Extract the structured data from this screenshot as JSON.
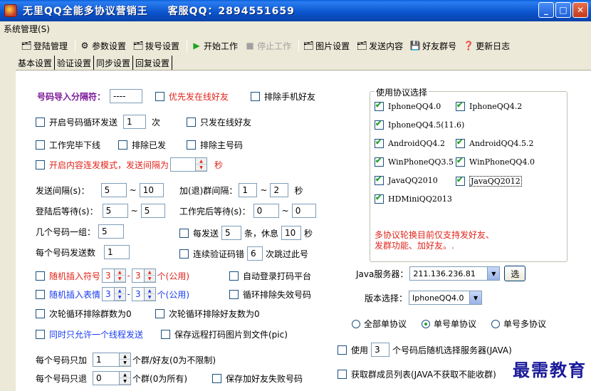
{
  "window": {
    "title": "无里QQ全能多协议营销王",
    "support": "客服QQ：2894551659",
    "min": "_",
    "max": "□",
    "close": "✕"
  },
  "menu": {
    "system": "系统管理(S)"
  },
  "toolbar": {
    "login": "登陆管理",
    "params": "参数设置",
    "dial": "拨号设置",
    "start": "开始工作",
    "stop": "停止工作",
    "image": "图片设置",
    "send": "发送内容",
    "group": "好友群号",
    "log": "更新日志"
  },
  "tabs": [
    "基本设置",
    "验证设置",
    "同步设置",
    "回复设置"
  ],
  "form": {
    "sep_label": "号码导入分隔符：",
    "sep_value": "----",
    "prio_online": "优先发在线好友",
    "excl_mobile": "排除手机好友",
    "loop_send": "开启号码循环发送",
    "loop_count": "1",
    "loop_unit": "次",
    "online_only": "只发在线好友",
    "offline_after": "工作完毕下线",
    "excl_sent": "排除已发",
    "excl_main": "排除主号码",
    "burst_mode": "开启内容连发模式，发送间隔为",
    "burst_value": "",
    "burst_unit": "秒",
    "send_interval": "发送间隔(s)：",
    "send_min": "5",
    "send_max": "10",
    "tilde": "~",
    "group_interval": "加(退)群间隔：",
    "group_min": "1",
    "group_max": "2",
    "group_unit": "秒",
    "login_wait": "登陆后等待(s)：",
    "login_min": "5",
    "login_max": "5",
    "done_wait": "工作完后等待(s)：",
    "done_min": "0",
    "done_max": "0",
    "per_group": "几个号码一组：",
    "per_group_val": "5",
    "each_send": "每发送",
    "each_send_val": "5",
    "rest_label": "条，休息",
    "rest_val": "10",
    "rest_unit": "秒",
    "per_num_send": "每个号码发送数",
    "per_num_send_val": "1",
    "captcha_err": "连续验证码错",
    "captcha_val": "6",
    "captcha_skip": "次跳过此号",
    "rand_symbol": "随机插入符号",
    "rand_symbol_a": "3",
    "rand_symbol_b": "3",
    "rand_unit": "个(公用)",
    "auto_login": "自动登录打码平台",
    "rand_emoji": "随机插入表情",
    "rand_emoji_a": "3",
    "rand_emoji_b": "3",
    "excl_fail": "循环排除失效号码",
    "next_excl_group": "次轮循环排除群数为0",
    "next_excl_friend": "次轮循环排除好友数为0",
    "multi_thread": "同时只允许一个线程发送",
    "save_captcha": "保存远程打码图片到文件(pic)",
    "per_num_add": "每个号码只加",
    "per_num_add_val": "1",
    "per_num_add_unit": "个群/好友(0为不限制)",
    "per_num_quit": "每个号码只退",
    "per_num_quit_val": "0",
    "per_num_quit_unit": "个群(0为所有)",
    "save_fail": "保存加好友失败号码"
  },
  "protocol": {
    "legend": "使用协议选择",
    "items": [
      {
        "label": "IphoneQQ4.0",
        "checked": true
      },
      {
        "label": "IphoneQQ4.2",
        "checked": true
      },
      {
        "label": "IphoneQQ4.5(11.6)",
        "checked": true
      },
      {
        "label": "AndroidQQ4.2",
        "checked": true
      },
      {
        "label": "AndroidQQ4.5.2",
        "checked": true
      },
      {
        "label": "WinPhoneQQ3.5",
        "checked": true
      },
      {
        "label": "WinPhoneQQ4.0",
        "checked": true
      },
      {
        "label": "JavaQQ2010",
        "checked": true
      },
      {
        "label": "JavaQQ2012",
        "checked": true
      },
      {
        "label": "HDMiniQQ2013",
        "checked": true
      }
    ],
    "note": "多协议轮换目前仅支持发好友、发群功能、加好友。."
  },
  "server": {
    "java_label": "Java服务器：",
    "java_value": "211.136.236.81",
    "select_btn": "选",
    "version_label": "版本选择：",
    "version_value": "IphoneQQ4.0",
    "radio_all_single": "全部单协议",
    "radio_single_single": "单号单协议",
    "radio_single_multi": "单号多协议",
    "use_label": "使用",
    "use_value": "3",
    "use_desc": "个号码后随机选择服务器(JAVA)",
    "fetch_members": "获取群成员列表(JAVA不获取不能收群)"
  },
  "watermark": "最需教育",
  "colors": {
    "title_bar": "#0a53cc",
    "red_label": "#e0261c",
    "blue_label": "#1a3cf0",
    "purple_label": "#7d1b9a"
  }
}
